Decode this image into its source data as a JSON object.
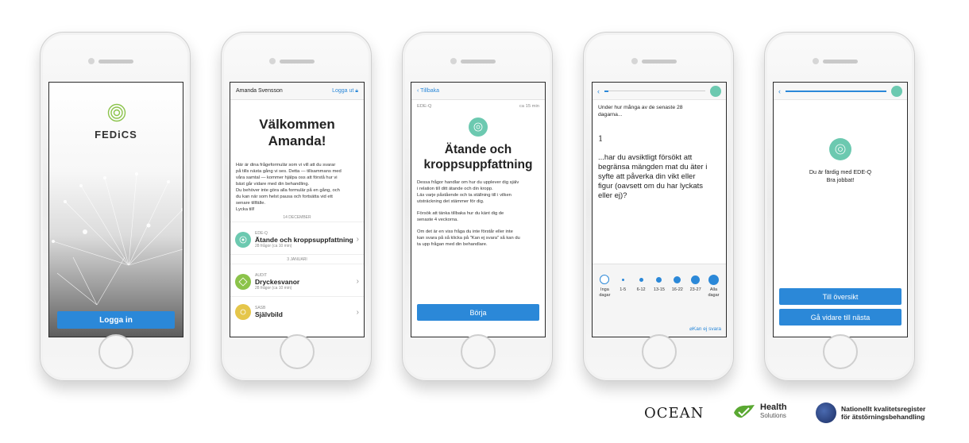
{
  "colors": {
    "accent": "#2b88d8",
    "teal": "#6cc9b0",
    "green": "#8bc34a",
    "yellow": "#e5c64a"
  },
  "phone1": {
    "brand": "FEDiCS",
    "login_label": "Logga in"
  },
  "phone2": {
    "user_name": "Amanda Svensson",
    "logout_label": "Logga ut",
    "welcome_line1": "Välkommen",
    "welcome_line2": "Amanda!",
    "intro_lines": [
      "Här är dina frågeformulär som vi vill att du svarar",
      "på tills nästa gång vi ses. Detta — tillsammans med",
      "våra samtal — kommer hjälpa oss att förstå hur vi",
      "bäst går vidare med din behandling.",
      "Du behöver inte göra alla formulär på en gång, och",
      "du kan när som helst pausa och fortsätta vid ett",
      "senare tillfälle.",
      "Lycka till!"
    ],
    "date_1": "14 DECEMBER",
    "date_2": "3 JANUARI",
    "forms": [
      {
        "code": "EDE-Q",
        "title": "Ätande och kroppsuppfattning",
        "meta": "28 frågor (ca 10 min)"
      },
      {
        "code": "AUDIT",
        "title": "Dryckesvanor",
        "meta": "28 frågor (ca 10 min)"
      },
      {
        "code": "SASB",
        "title": "Självbild",
        "meta": ""
      }
    ]
  },
  "phone3": {
    "back_label": "Tillbaka",
    "code": "EDE-Q",
    "duration": "ca 15 min",
    "title_line1": "Ätande och",
    "title_line2": "kroppsuppfattning",
    "para1_lines": [
      "Dessa frågor handlar om hur du upplever dig själv",
      "i relation till ditt ätande och din kropp.",
      "Läs varje påstående och ta ställning till i vilken",
      "utsträckning det stämmer för dig."
    ],
    "para2_lines": [
      "Försök att tänka tillbaka hur du känt dig de",
      "senaste 4 veckorna."
    ],
    "para3_lines": [
      "Om det är en viss fråga du inte förstår eller inte",
      "kan svara på så klicka på \"Kan ej svara\" så kan du",
      "ta upp frågan med din behandlare."
    ],
    "start_label": "Börja"
  },
  "phone4": {
    "progress": 0.04,
    "subtitle_line1": "Under hur många av de senaste 28",
    "subtitle_line2": "dagarna...",
    "question_number": "1",
    "question_lines": [
      "...har du avsiktligt försökt att",
      "begränsa mängden mat du äter i",
      "syfte att påverka din vikt eller",
      "figur (oavsett om du har lyckats",
      "eller ej)?"
    ],
    "options": [
      {
        "label1": "Inga",
        "label2": "dagar"
      },
      {
        "label1": "1-5",
        "label2": ""
      },
      {
        "label1": "6-12",
        "label2": ""
      },
      {
        "label1": "13-15",
        "label2": ""
      },
      {
        "label1": "16-22",
        "label2": ""
      },
      {
        "label1": "23-27",
        "label2": ""
      },
      {
        "label1": "Alla",
        "label2": "dagar"
      }
    ],
    "cant_answer_label": "Kan ej svara"
  },
  "phone5": {
    "progress": 1.0,
    "done_line1": "Du är färdig med EDE-Q",
    "done_line2": "Bra jobbat!",
    "overview_label": "Till översikt",
    "next_label": "Gå vidare till nästa"
  },
  "footer": {
    "ocean": "OCEAN",
    "health_line1": "Health",
    "health_line2": "Solutions",
    "nkr_line1": "Nationellt kvalitetsregister",
    "nkr_line2": "för ätstörningsbehandling"
  }
}
